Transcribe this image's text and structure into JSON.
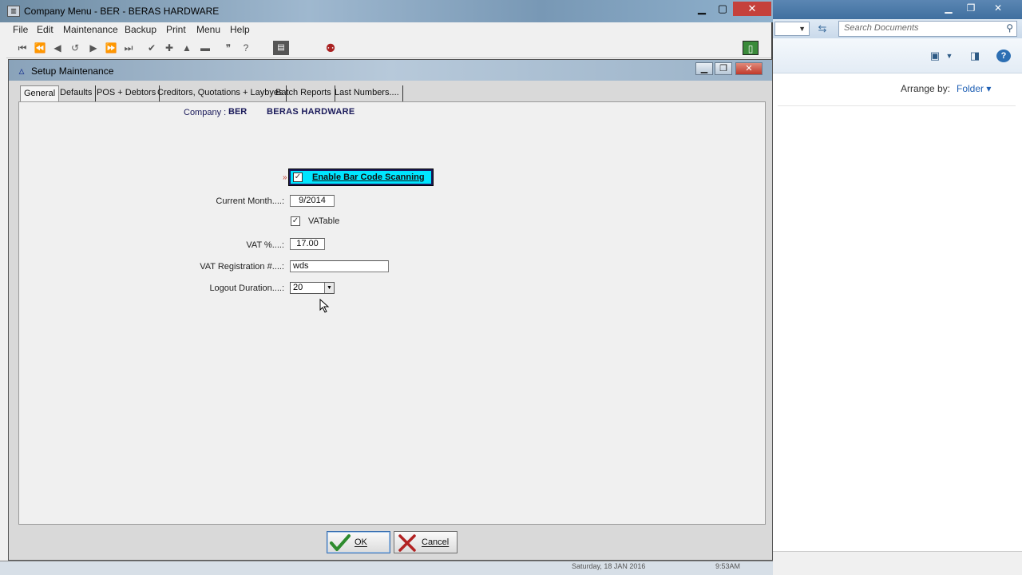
{
  "explorer": {
    "search_placeholder": "Search Documents",
    "arrange_label": "Arrange by:",
    "arrange_value": "Folder",
    "help_glyph": "?"
  },
  "main_window": {
    "title": "Company Menu - BER    - BERAS HARDWARE",
    "menu": [
      "File",
      "Edit",
      "Maintenance",
      "Backup",
      "Print",
      "Menu",
      "Help"
    ]
  },
  "setup_window": {
    "title": "Setup Maintenance",
    "tabs": [
      "General",
      "Defaults",
      "POS + Debtors",
      "Creditors, Quotations + Laybyes",
      "Batch Reports",
      "Last Numbers...."
    ],
    "active_tab": "General",
    "company": {
      "label": "Company  :",
      "code": "BER",
      "name": "BERAS HARDWARE"
    },
    "barcode": {
      "marker": "»",
      "label": "Enable Bar Code Scanning",
      "checked": true
    },
    "fields": {
      "current_month_label": "Current Month....:",
      "current_month_value": "9/2014",
      "vatable_label": "VATable",
      "vatable_checked": true,
      "vat_pct_label": "VAT %....:",
      "vat_pct_value": "17.00",
      "vat_reg_label": "VAT Registration #....:",
      "vat_reg_value": "wds",
      "logout_label": "Logout Duration....:",
      "logout_value": "20"
    },
    "buttons": {
      "ok": "OK",
      "cancel": "Cancel"
    }
  },
  "status": {
    "date_text": "Saturday, 18 JAN 2016",
    "time_text": "9:53AM"
  },
  "colors": {
    "barcode_highlight": "#00e5ff",
    "company_text": "#1a1a5a",
    "ok_check": "#2e8b2e",
    "cancel_x": "#b22222"
  }
}
